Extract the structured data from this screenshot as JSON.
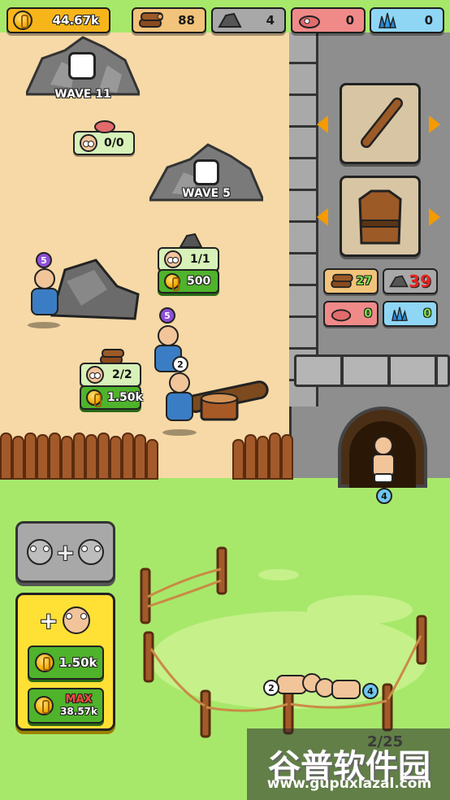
{
  "top_bar": {
    "coins": "44.67k",
    "wood": "88",
    "stone": "4",
    "meat": "0",
    "crystal": "0"
  },
  "mines": {
    "wave11_label": "WAVE 11",
    "wave11_workers": "0/0",
    "wave5_label": "WAVE 5",
    "stone_workers": "1/1",
    "stone_cost": "500",
    "wood_workers": "2/2",
    "wood_cost": "1.50k"
  },
  "levels": {
    "miner_top": "5",
    "miner_mid": "5",
    "lumber": "2",
    "gate_worker": "4",
    "pen_left": "2",
    "pen_right": "4"
  },
  "equipment": {
    "costs": {
      "wood": "27",
      "stone": "39",
      "meat": "0",
      "crystal": "0"
    }
  },
  "buttons": {
    "merge_plus": "+",
    "hire_plus": "+",
    "hire_cost": "1.50k",
    "max_label": "MAX",
    "max_cost": "38.57k"
  },
  "pen": {
    "counter": "2/25"
  },
  "watermark": {
    "title": "谷普软件园",
    "url": "www.gupuxlazal.com"
  },
  "colors": {
    "sand": "#f6d9a6",
    "grass": "#a7e86a",
    "castle": "#8a8a8a",
    "coin_pill": "#f7b51a",
    "wood_pill": "#f2c37a",
    "stone_pill": "#a8a8a8",
    "meat_pill": "#f08a88",
    "crystal_pill": "#8fd6f5",
    "green_button": "#4fb32b",
    "hire_panel": "#ffe035"
  }
}
